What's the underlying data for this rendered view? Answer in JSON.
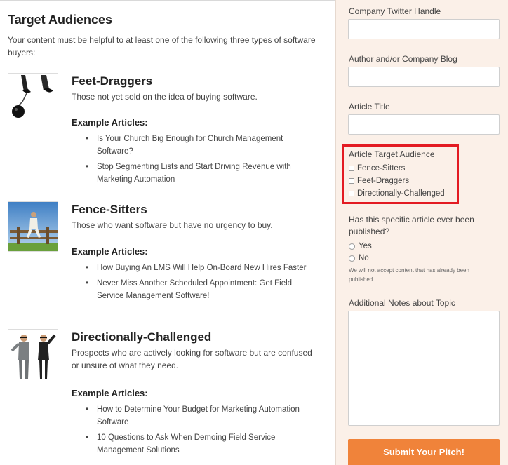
{
  "left": {
    "title": "Target Audiences",
    "intro": "Your content must be helpful to at least one of the following three types of software buyers:",
    "audiences": [
      {
        "title": "Feet-Draggers",
        "desc": "Those not yet sold on the idea of buying software.",
        "example_label": "Example Articles:",
        "examples": [
          "Is Your Church Big Enough for Church Management Software?",
          "Stop Segmenting Lists and Start Driving Revenue with Marketing Automation"
        ]
      },
      {
        "title": "Fence-Sitters",
        "desc": "Those who want software but have no urgency to buy.",
        "example_label": "Example Articles:",
        "examples": [
          "How Buying An LMS Will Help On-Board New Hires Faster",
          "Never Miss Another Scheduled Appointment: Get Field Service Management Software!"
        ]
      },
      {
        "title": "Directionally-Challenged",
        "desc": "Prospects who are actively looking for software but are confused or unsure of what they need.",
        "example_label": "Example Articles:",
        "examples": [
          "How to Determine Your Budget for Marketing Automation Software",
          "10 Questions to Ask When Demoing Field Service Management Solutions"
        ]
      }
    ]
  },
  "form": {
    "twitter_label": "Company Twitter Handle",
    "twitter_value": "",
    "blog_label": "Author and/or Company Blog",
    "blog_value": "",
    "article_title_label": "Article Title",
    "article_title_value": "",
    "audience_label": "Article Target Audience",
    "audience_options": [
      "Fence-Sitters",
      "Feet-Draggers",
      "Directionally-Challenged"
    ],
    "published_label": "Has this specific article ever been published?",
    "published_options": [
      "Yes",
      "No"
    ],
    "published_note": "We will not accept content that has already been published.",
    "notes_label": "Additional Notes about Topic",
    "notes_value": "",
    "submit_label": "Submit Your Pitch!"
  },
  "colors": {
    "panel_bg": "#fbf0e8",
    "submit_bg": "#f0833a",
    "highlight": "#e31b23"
  }
}
